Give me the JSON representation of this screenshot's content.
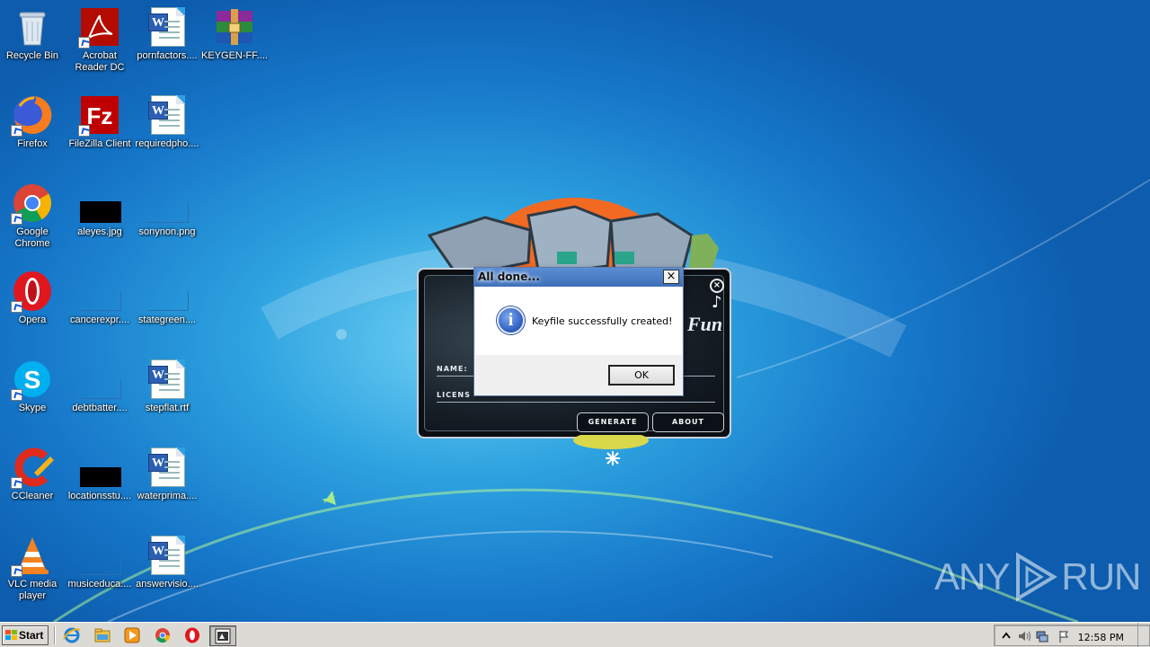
{
  "desktop": {
    "icons": [
      {
        "label": "Recycle Bin",
        "icon": "recycle-bin-icon"
      },
      {
        "label": "Acrobat Reader DC",
        "icon": "acrobat-icon"
      },
      {
        "label": "pornfactors....",
        "icon": "word-doc-icon"
      },
      {
        "label": "KEYGEN-FF....",
        "icon": "winrar-archive-icon"
      },
      {
        "label": "Firefox",
        "icon": "firefox-icon"
      },
      {
        "label": "FileZilla Client",
        "icon": "filezilla-icon"
      },
      {
        "label": "requiredpho....",
        "icon": "word-doc-icon"
      },
      {
        "label": "Google Chrome",
        "icon": "chrome-icon"
      },
      {
        "label": "aleyes.jpg",
        "icon": "image-thumb-icon"
      },
      {
        "label": "sonynon.png",
        "icon": "image-thumb-icon"
      },
      {
        "label": "Opera",
        "icon": "opera-icon"
      },
      {
        "label": "cancerexpr....",
        "icon": "image-thumb-icon"
      },
      {
        "label": "stategreen....",
        "icon": "image-thumb-icon"
      },
      {
        "label": "Skype",
        "icon": "skype-icon"
      },
      {
        "label": "debtbatter....",
        "icon": "image-thumb-icon"
      },
      {
        "label": "stepflat.rtf",
        "icon": "word-doc-icon"
      },
      {
        "label": "CCleaner",
        "icon": "ccleaner-icon"
      },
      {
        "label": "locationsstu....",
        "icon": "image-thumb-icon"
      },
      {
        "label": "waterprima....",
        "icon": "word-doc-icon"
      },
      {
        "label": "VLC media player",
        "icon": "vlc-icon"
      },
      {
        "label": "musiceduca....",
        "icon": "image-thumb-icon"
      },
      {
        "label": "answervisio....",
        "icon": "word-doc-icon"
      }
    ]
  },
  "keygen": {
    "name_label": "NAME:",
    "license_label": "LICENS",
    "generate_label": "GENERATE",
    "about_label": "ABOUT",
    "title_fragment": "Fun",
    "music_glyph": "♪",
    "close_glyph": "×"
  },
  "dialog": {
    "title": "All done...",
    "close_glyph": "×",
    "message": "Keyfile successfully created!",
    "ok_label": "OK",
    "info_glyph": "i"
  },
  "watermark": {
    "left": "ANY",
    "right": "RUN"
  },
  "taskbar": {
    "start_label": "Start",
    "clock": "12:58 PM"
  }
}
